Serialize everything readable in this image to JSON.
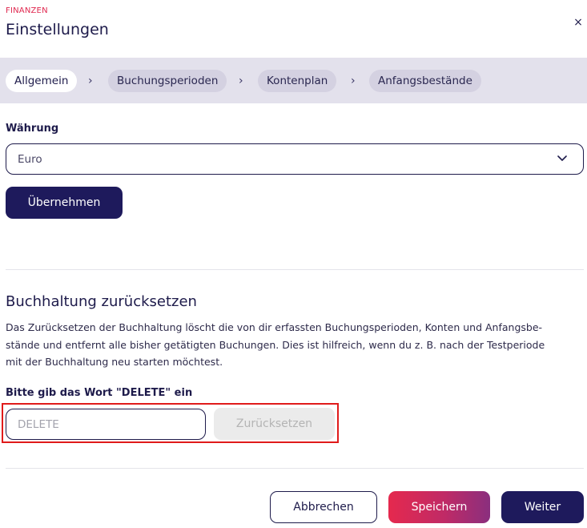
{
  "header": {
    "eyebrow": "FINANZEN",
    "title": "Einstellungen",
    "close_icon": "×"
  },
  "steps": [
    {
      "label": "Allgemein",
      "active": true
    },
    {
      "label": "Buchungsperioden",
      "active": false
    },
    {
      "label": "Kontenplan",
      "active": false
    },
    {
      "label": "Anfangsbestände",
      "active": false
    }
  ],
  "step_separator": "›",
  "currency": {
    "label": "Währung",
    "selected": "Euro",
    "apply_label": "Übernehmen"
  },
  "reset": {
    "title": "Buchhaltung zurücksetzen",
    "description_line1": "Das Zurücksetzen der Buchhaltung löscht die von dir erfassten Buchungsperioden, Konten und Anfangsbe-",
    "description_line2": "stände und entfernt alle bisher getätigten Buchungen. Dies ist hilfreich, wenn du z. B. nach der Testperiode",
    "description_line3": "mit der Buchhaltung neu starten möchtest.",
    "confirm_label": "Bitte gib das Wort \"DELETE\" ein",
    "confirm_placeholder": "DELETE",
    "confirm_value": "",
    "reset_button": "Zurücksetzen"
  },
  "footer": {
    "cancel": "Abbrechen",
    "save": "Speichern",
    "next": "Weiter"
  },
  "colors": {
    "primary": "#1e1a5c",
    "accent": "#e5294e",
    "stepbar_bg": "#e3e1ec",
    "highlight": "#e01b1b"
  },
  "icons": {
    "close": "close-icon",
    "step_separator": "chevron-right-icon",
    "select_caret": "chevron-down-icon"
  }
}
